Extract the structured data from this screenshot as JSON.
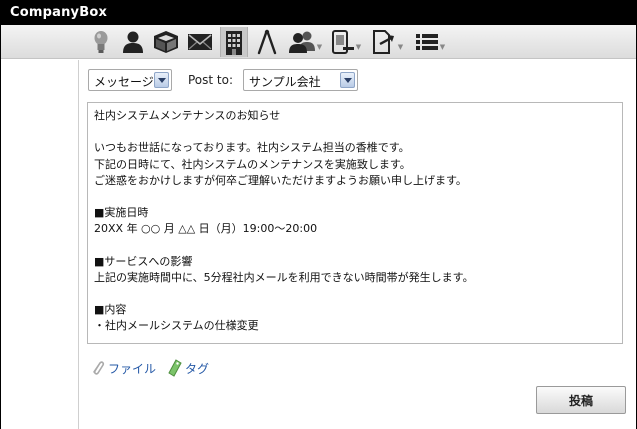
{
  "window": {
    "title": "CompanyBox"
  },
  "toolbar": {
    "icons": [
      {
        "name": "lightbulb-icon"
      },
      {
        "name": "user-icon"
      },
      {
        "name": "box-icon"
      },
      {
        "name": "mail-icon"
      },
      {
        "name": "building-icon",
        "active": true
      },
      {
        "name": "compass-icon"
      },
      {
        "name": "group-icon",
        "dropdown": true
      },
      {
        "name": "contact-card-icon",
        "dropdown": true
      },
      {
        "name": "document-export-icon",
        "dropdown": true
      },
      {
        "name": "list-icon",
        "dropdown": true
      }
    ],
    "dropdown_arrow": "▼"
  },
  "compose": {
    "type_select": {
      "value": "メッセージ"
    },
    "post_to_label": "Post to:",
    "recipient_select": {
      "value": "サンプル会社"
    },
    "body_lines": [
      "社内システムメンテナンスのお知らせ",
      "",
      "いつもお世話になっております。社内システム担当の香椎です。",
      "下記の日時にて、社内システムのメンテナンスを実施致します。",
      "ご迷惑をおかけしますが何卒ご理解いただけますようお願い申し上げます。",
      "",
      "■実施日時",
      "20XX 年 ○○ 月 △△ 日（月）19:00〜20:00",
      "",
      "■サービスへの影響",
      "上記の実施時間中に、5分程社内メールを利用できない時間帯が発生します。",
      "",
      "■内容",
      "・社内メールシステムの仕様変更"
    ],
    "attach_file_label": "ファイル",
    "attach_tag_label": "タグ",
    "post_button_label": "投稿"
  },
  "colors": {
    "titlebar": "#000000",
    "link": "#2458a6",
    "select_button": "#b9cbe6"
  }
}
